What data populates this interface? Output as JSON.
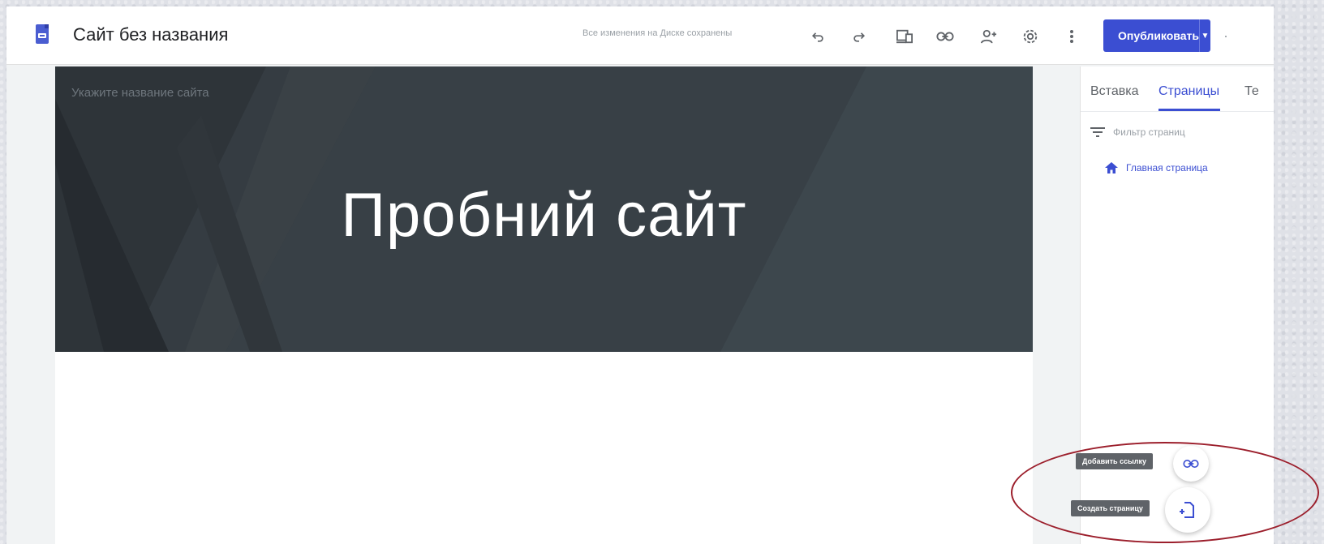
{
  "header": {
    "title": "Сайт без названия",
    "save_status": "Все изменения на Диске сохранены",
    "publish_label": "Опубликовать",
    "icons": [
      "undo-icon",
      "redo-icon",
      "preview-icon",
      "link-icon",
      "add-person-icon",
      "settings-icon",
      "more-vert-icon",
      "dropdown-arrow-icon"
    ]
  },
  "canvas": {
    "site_name_placeholder": "Укажите название сайта",
    "hero_title": "Пробний сайт"
  },
  "panel": {
    "tabs": [
      {
        "label": "Вставка",
        "active": false
      },
      {
        "label": "Страницы",
        "active": true
      },
      {
        "label": "Те",
        "active": false
      }
    ],
    "filter_placeholder": "Фильтр страниц",
    "pages": [
      {
        "label": "Главная страница",
        "icon": "home-icon"
      }
    ]
  },
  "fabs": {
    "add_link_tooltip": "Добавить ссылку",
    "create_page_tooltip": "Создать страницу"
  },
  "colors": {
    "accent": "#3b4ed2",
    "banner": "#353c42",
    "annotation": "#9c1f2c"
  }
}
